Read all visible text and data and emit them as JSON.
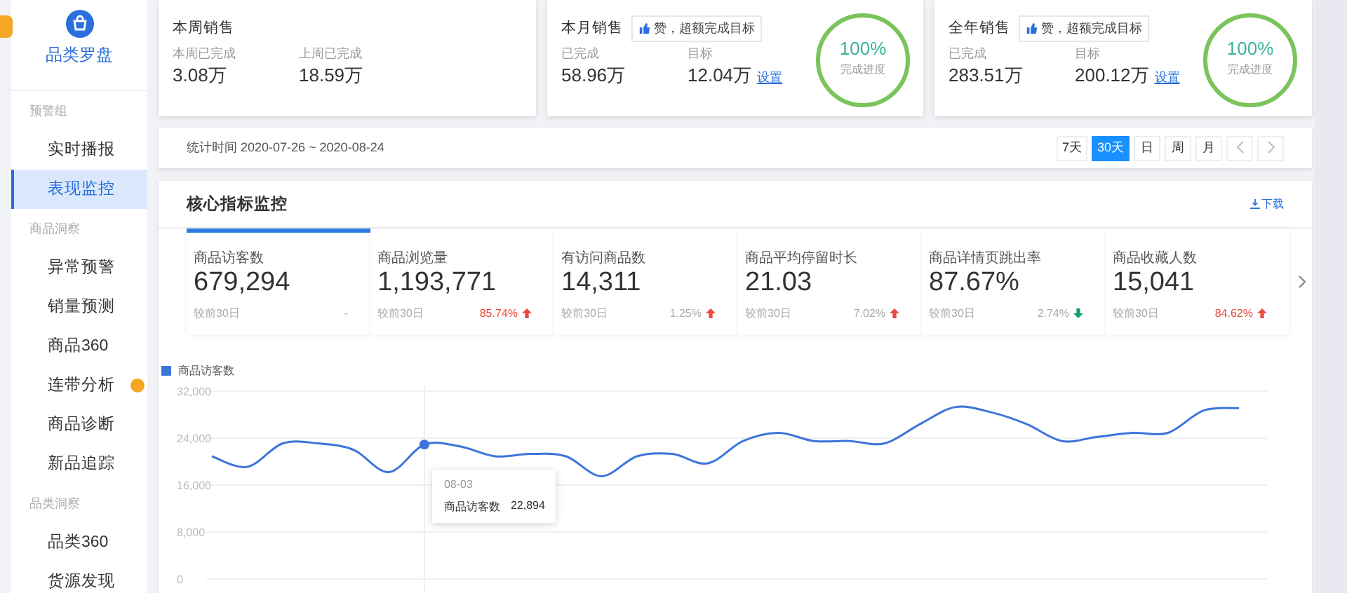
{
  "sidebar": {
    "logo_text": "品类罗盘",
    "groups": [
      {
        "title": "预警组",
        "items": [
          {
            "label": "实时播报",
            "selected": false,
            "dot": false
          },
          {
            "label": "表现监控",
            "selected": true,
            "dot": false
          }
        ]
      },
      {
        "title": "商品洞察",
        "items": [
          {
            "label": "异常预警",
            "selected": false,
            "dot": false
          },
          {
            "label": "销量预测",
            "selected": false,
            "dot": false
          },
          {
            "label": "商品360",
            "selected": false,
            "dot": false
          },
          {
            "label": "连带分析",
            "selected": false,
            "dot": true
          },
          {
            "label": "商品诊断",
            "selected": false,
            "dot": false
          },
          {
            "label": "新品追踪",
            "selected": false,
            "dot": false
          }
        ]
      },
      {
        "title": "品类洞察",
        "items": [
          {
            "label": "品类360",
            "selected": false,
            "dot": false
          },
          {
            "label": "货源发现",
            "selected": false,
            "dot": false
          }
        ]
      }
    ]
  },
  "sales_cards": [
    {
      "title": "本周销售",
      "stats": [
        {
          "label": "本周已完成",
          "value": "3.08万"
        },
        {
          "label": "上周已完成",
          "value": "18.59万"
        }
      ]
    },
    {
      "title": "本月销售",
      "badge": "赞，超额完成目标",
      "stats": [
        {
          "label": "已完成",
          "value": "58.96万"
        },
        {
          "label": "目标",
          "value": "12.04万",
          "link": "设置"
        }
      ],
      "ring": {
        "level": 1,
        "text": "100%",
        "caption": "完成进度"
      }
    },
    {
      "title": "全年销售",
      "badge": "赞，超额完成目标",
      "stats": [
        {
          "label": "已完成",
          "value": "283.51万"
        },
        {
          "label": "目标",
          "value": "200.12万",
          "link": "设置"
        }
      ],
      "ring": {
        "level": 1,
        "text": "100%",
        "caption": "完成进度"
      }
    }
  ],
  "date_bar": {
    "text": "统计时间 2020-07-26 ~ 2020-08-24",
    "buttons": [
      {
        "label": "7天",
        "selected": false
      },
      {
        "label": "30天",
        "selected": true
      },
      {
        "label": "日",
        "selected": false
      },
      {
        "label": "周",
        "selected": false
      },
      {
        "label": "月",
        "selected": false
      }
    ]
  },
  "core": {
    "title": "核心指标监控",
    "download": "下载",
    "metrics": [
      {
        "label": "商品访客数",
        "value": "679,294",
        "compare": "较前30日",
        "change": "-",
        "kind": "flat",
        "alert": false,
        "selected": true
      },
      {
        "label": "商品浏览量",
        "value": "1,193,771",
        "compare": "较前30日",
        "change": "85.74%",
        "kind": "up",
        "alert": true,
        "selected": false
      },
      {
        "label": "有访问商品数",
        "value": "14,311",
        "compare": "较前30日",
        "change": "1.25%",
        "kind": "up",
        "alert": false,
        "selected": false
      },
      {
        "label": "商品平均停留时长",
        "value": "21.03",
        "compare": "较前30日",
        "change": "7.02%",
        "kind": "up",
        "alert": false,
        "selected": false
      },
      {
        "label": "商品详情页跳出率",
        "value": "87.67%",
        "compare": "较前30日",
        "change": "2.74%",
        "kind": "down",
        "alert": false,
        "selected": false
      },
      {
        "label": "商品收藏人数",
        "value": "15,041",
        "compare": "较前30日",
        "change": "84.62%",
        "kind": "up",
        "alert": true,
        "selected": false
      }
    ],
    "tooltip": {
      "title": "08-03",
      "label": "商品访客数",
      "value": "22,894"
    },
    "chart_data": {
      "type": "line",
      "grid": true,
      "yticks": [
        {
          "value": 0,
          "label": "0"
        },
        {
          "value": 8000,
          "label": "8,000"
        },
        {
          "value": 16000,
          "label": "16,000"
        },
        {
          "value": 24000,
          "label": "24,000"
        },
        {
          "value": 32000,
          "label": "32,000"
        }
      ],
      "ylim": [
        0,
        32000
      ],
      "series": [
        {
          "name": "商品访客数",
          "color": "#3d74db",
          "values": [
            20900,
            19100,
            23100,
            23100,
            22000,
            18200,
            22900,
            22600,
            20900,
            21300,
            20900,
            17500,
            20900,
            21300,
            19700,
            23500,
            24900,
            23500,
            23500,
            23100,
            26400,
            29300,
            28400,
            26400,
            23500,
            24200,
            24900,
            24900,
            28700,
            29100
          ]
        }
      ]
    }
  }
}
